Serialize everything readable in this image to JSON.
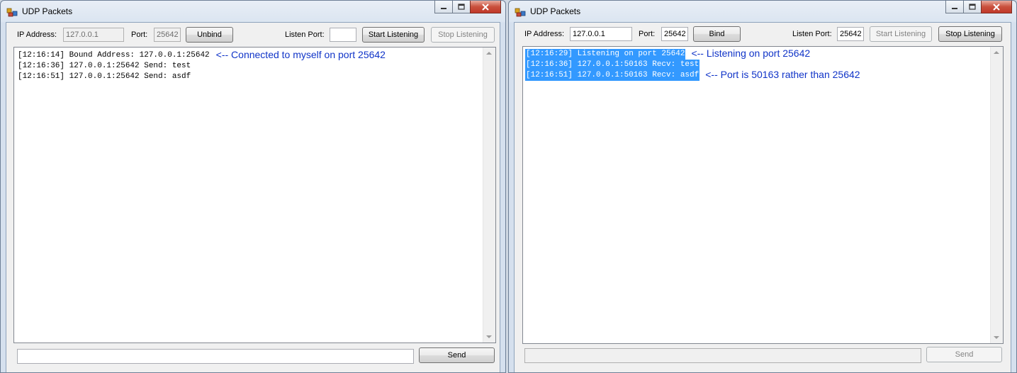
{
  "left_window": {
    "title": "UDP Packets",
    "ip_label": "IP Address:",
    "ip_value": "127.0.0.1",
    "port_label": "Port:",
    "port_value": "25642",
    "bind_button": "Unbind",
    "listen_port_label": "Listen Port:",
    "listen_port_value": "",
    "start_listening": "Start Listening",
    "stop_listening": "Stop Listening",
    "log": [
      {
        "text": "[12:16:14] Bound Address: 127.0.0.1:25642",
        "note": "<-- Connected to myself on port 25642"
      },
      {
        "text": "[12:16:36] 127.0.0.1:25642 Send: test",
        "note": ""
      },
      {
        "text": "[12:16:51] 127.0.0.1:25642 Send: asdf",
        "note": ""
      }
    ],
    "message_value": "",
    "send_button": "Send"
  },
  "right_window": {
    "title": "UDP Packets",
    "ip_label": "IP Address:",
    "ip_value": "127.0.0.1",
    "port_label": "Port:",
    "port_value": "25642",
    "bind_button": "Bind",
    "listen_port_label": "Listen Port:",
    "listen_port_value": "25642",
    "start_listening": "Start Listening",
    "stop_listening": "Stop Listening",
    "log": [
      {
        "text": "[12:16:29] Listening on port 25642",
        "note": "<-- Listening on port 25642"
      },
      {
        "text": "[12:16:36] 127.0.0.1:50163 Recv: test",
        "note": ""
      },
      {
        "text": "[12:16:51] 127.0.0.1:50163 Recv: asdf",
        "note": "<-- Port is 50163 rather than 25642"
      }
    ],
    "message_value": "",
    "send_button": "Send"
  },
  "colors": {
    "annotation": "#1034c8",
    "selection": "#3399ff",
    "window_frame": "#dbe5f1"
  },
  "icons": {
    "app": "udp-app-icon",
    "minimize": "minimize-icon",
    "maximize": "maximize-icon",
    "close": "close-icon",
    "scroll_up": "scroll-up-arrow-icon",
    "scroll_down": "scroll-down-arrow-icon"
  }
}
